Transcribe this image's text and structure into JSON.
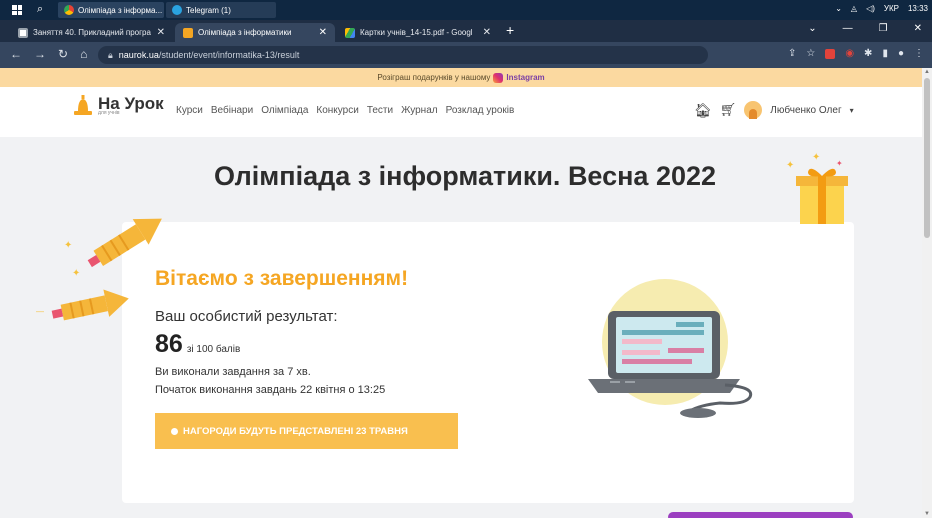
{
  "taskbar": {
    "apps": [
      {
        "label": "Олімпіада з інформа...",
        "icon": "chrome-icon"
      },
      {
        "label": "Telegram (1)",
        "icon": "telegram-icon"
      }
    ],
    "tray": {
      "lang": "УКР",
      "time": "13:33"
    }
  },
  "browser": {
    "tabs": [
      {
        "label": "Заняття 40. Прикладний програ",
        "icon": "classroom-icon"
      },
      {
        "label": "Олімпіада з інформатики",
        "icon": "naurok-icon"
      },
      {
        "label": "Картки учнів_14-15.pdf - Googl",
        "icon": "drive-icon"
      }
    ],
    "url_host": "naurok.ua",
    "url_path": "/student/event/informatika-13/result"
  },
  "promo": {
    "text": "Розіграш подарунків у нашому",
    "link": "Instagram"
  },
  "header": {
    "logo": "На Урок",
    "logo_sub": "для учнів",
    "menu": [
      "Курси",
      "Вебінари",
      "Олімпіада",
      "Конкурси",
      "Тести",
      "Журнал",
      "Розклад уроків"
    ],
    "user": "Любченко Олег"
  },
  "page": {
    "title": "Олімпіада з інформатики. Весна 2022",
    "congrats": "Вітаємо з завершенням!",
    "result_label": "Ваш особистий результат:",
    "score": "86",
    "score_of": "зі 100 балів",
    "time_text": "Ви виконали завдання за 7 хв.",
    "start_text": "Початок виконання завдань 22 квітня о 13:25",
    "cta": "НАГОРОДИ БУДУТЬ ПРЕДСТАВЛЕНІ 23 ТРАВНЯ"
  },
  "colors": {
    "accent": "#f5a623",
    "cta": "#f9bf4f",
    "header_dark": "#1f2e44"
  }
}
